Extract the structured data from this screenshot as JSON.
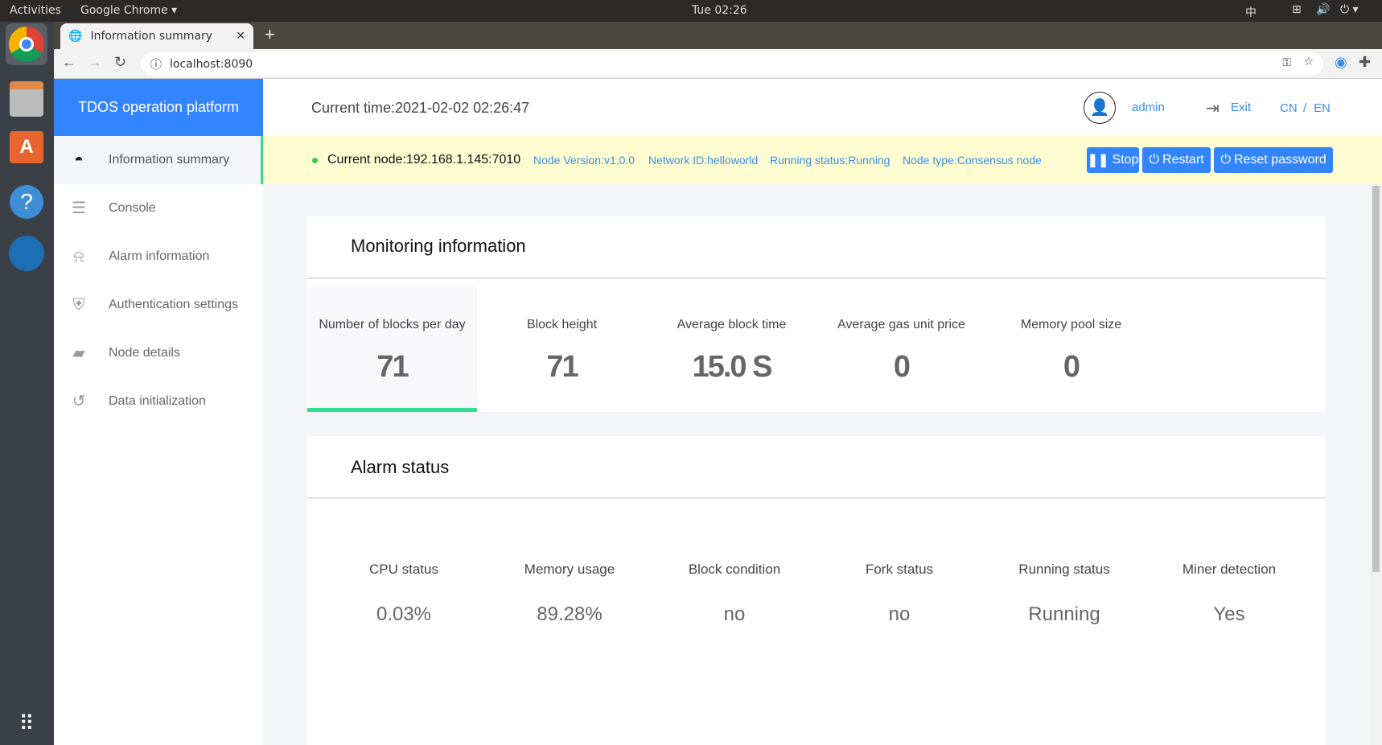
{
  "os": {
    "activities": "Activities",
    "app_name": "Google Chrome",
    "clock": "Tue 02:26",
    "input_method": "中"
  },
  "browser": {
    "tab_title": "Information summary",
    "url": "localhost:8090"
  },
  "app": {
    "brand": "TDOS operation platform",
    "current_time": "Current time:2021-02-02 02:26:47",
    "user": "admin",
    "exit": "Exit",
    "lang_cn": "CN",
    "lang_sep": "/",
    "lang_en": "EN",
    "sidebar": [
      {
        "label": "Information summary",
        "icon": "dashboard-icon"
      },
      {
        "label": "Console",
        "icon": "sliders-icon"
      },
      {
        "label": "Alarm information",
        "icon": "alarm-icon"
      },
      {
        "label": "Authentication settings",
        "icon": "shield-key-icon"
      },
      {
        "label": "Node details",
        "icon": "monitor-chart-icon"
      },
      {
        "label": "Data initialization",
        "icon": "reset-icon"
      }
    ],
    "node": {
      "current": "Current node:192.168.1.145:7010",
      "version": "Node Version:v1.0.0",
      "network": "Network ID:helloworld",
      "status": "Running status:Running",
      "type": "Node type:Consensus node"
    },
    "buttons": {
      "stop": "Stop",
      "restart": "Restart",
      "reset": "Reset password"
    },
    "monitoring": {
      "title": "Monitoring information",
      "tiles": [
        {
          "label": "Number of blocks per day",
          "value": "71"
        },
        {
          "label": "Block height",
          "value": "71"
        },
        {
          "label": "Average block time",
          "value": "15.0 S"
        },
        {
          "label": "Average gas unit price",
          "value": "0"
        },
        {
          "label": "Memory pool size",
          "value": "0"
        }
      ]
    },
    "alarm": {
      "title": "Alarm status",
      "items": [
        {
          "label": "CPU status",
          "value": "0.03%"
        },
        {
          "label": "Memory usage",
          "value": "89.28%"
        },
        {
          "label": "Block condition",
          "value": "no"
        },
        {
          "label": "Fork status",
          "value": "no"
        },
        {
          "label": "Running status",
          "value": "Running"
        },
        {
          "label": "Miner detection",
          "value": "Yes"
        }
      ]
    }
  }
}
